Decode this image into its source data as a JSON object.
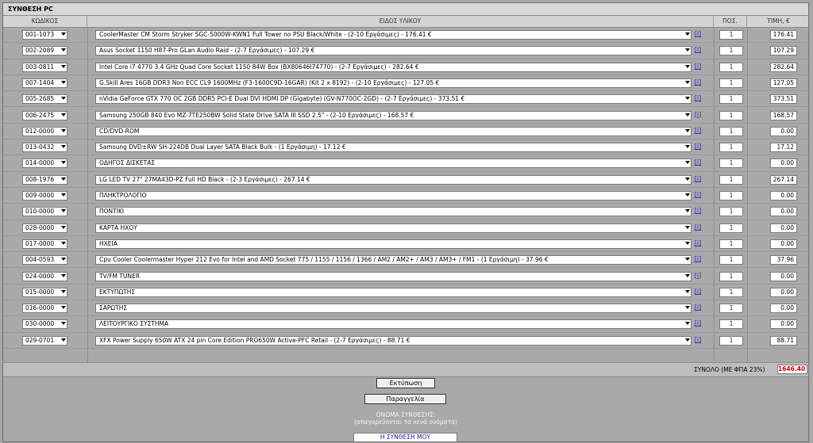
{
  "title": "ΣΥΝΘΕΣΗ PC",
  "headers": {
    "code": "ΚΩΔΙΚΟΣ",
    "description": "ΕΙΔΟΣ ΥΛΙΚΟΥ",
    "quantity": "ΠΟΣ.",
    "price": "ΤΙΜΗ, €"
  },
  "info_icon": "[i]",
  "rows": [
    {
      "code": "001-1073",
      "description": "CoolerMaster CM Storm Stryker SGC-5000W-KWN1 Full Tower no PSU Black/White - (2-10 Εργάσιμες) - 176.41 €",
      "qty": "1",
      "price": "176.41"
    },
    {
      "code": "002-2089",
      "description": "Asus Socket 1150 H87-Pro GLan Audio Raid - (2-7 Εργάσιμες) - 107.29 €",
      "qty": "1",
      "price": "107.29"
    },
    {
      "code": "003-0811",
      "description": "Intel Core i7 4770 3.4 GHz Quad Core Socket 1150 84W Box (BX80646I74770) - (2-7 Εργάσιμες) - 282.64 €",
      "qty": "1",
      "price": "282.64"
    },
    {
      "code": "007-1404",
      "description": "G.Skill Ares 16GB DDR3 Non ECC CL9 1600MHz (F3-1600C9D-16GAR) (Kit 2 x 8192) - (2-10 Εργάσιμες) - 127.05 €",
      "qty": "1",
      "price": "127.05"
    },
    {
      "code": "005-2685",
      "description": "nVidia GeForce GTX 770 OC 2GB DDR5 PCI-E Dual DVI HDMI DP (Gigabyte) (GV-N770OC-2GD) - (2-7 Εργάσιμες) - 373.51 €",
      "qty": "1",
      "price": "373.51"
    },
    {
      "code": "006-2475",
      "description": "Samsung 250GB 840 Evo MZ-7TE250BW Solid State Drive SATA III SSD 2.5\" - (2-10 Εργάσιμες) - 168.57 €",
      "qty": "1",
      "price": "168.57"
    },
    {
      "code": "012-0000",
      "description": "CD/DVD-ROM",
      "qty": "1",
      "price": "0.00"
    },
    {
      "code": "013-0432",
      "description": "Samsung DVD±RW SH-224DB Dual Layer SATA Black Bulk - (1 Εργάσιμη) - 17.12 €",
      "qty": "1",
      "price": "17.12"
    },
    {
      "code": "014-0000",
      "description": "ΟΔΗΓΟΣ ΔΙΣΚΕΤΑΣ",
      "qty": "1",
      "price": "0.00"
    },
    {
      "code": "008-1976",
      "description": "LG LED TV 27\" 27MA43D-PZ Full HD Black - (2-3 Εργάσιμες) - 267.14 €",
      "qty": "1",
      "price": "267.14"
    },
    {
      "code": "009-0000",
      "description": "ΠΛΗΚΤΡΟΛΟΓΙΟ",
      "qty": "1",
      "price": "0.00"
    },
    {
      "code": "010-0000",
      "description": "ΠΟΝΤΙΚΙ",
      "qty": "1",
      "price": "0.00"
    },
    {
      "code": "028-0000",
      "description": "ΚΑΡΤΑ ΗΧΟΥ",
      "qty": "1",
      "price": "0.00"
    },
    {
      "code": "017-0000",
      "description": "ΗΧΕΙΑ",
      "qty": "1",
      "price": "0.00"
    },
    {
      "code": "004-0593",
      "description": "Cpu Cooler Coolermaster Hyper 212 Evo for Intel and AMD Socket 775 / 1155 / 1156 / 1366 / AM2 / AM2+ / AM3 / AM3+ / FM1 - (1 Εργάσιμη) - 37.96 €",
      "qty": "1",
      "price": "37.96"
    },
    {
      "code": "024-0000",
      "description": "TV/FM TUNER",
      "qty": "1",
      "price": "0.00"
    },
    {
      "code": "015-0000",
      "description": "ΕΚΤΥΠΩΤΗΣ",
      "qty": "1",
      "price": "0.00"
    },
    {
      "code": "016-0000",
      "description": "ΣΑΡΩΤΗΣ",
      "qty": "1",
      "price": "0.00"
    },
    {
      "code": "030-0000",
      "description": "ΛΕΙΤΟΥΡΓΙΚΟ ΣΥΣΤΗΜΑ",
      "qty": "1",
      "price": "0.00"
    },
    {
      "code": "029-0701",
      "description": "XFX Power Supply 650W ATX 24 pin Core Edition PRO650W Active-PFC Retail - (2-7 Εργάσιμες) - 88.71 €",
      "qty": "1",
      "price": "88.71"
    }
  ],
  "total": {
    "label": "ΣΥΝΟΛΟ (ΜΕ ΦΠΑ 23%)",
    "value": "1646.40"
  },
  "buttons": {
    "print": "Εκτύπωση",
    "order": "Παραγγελία"
  },
  "composition_name": {
    "label": "ΟΝΟΜΑ ΣΥΝΘΕΣΗΣ:",
    "hint": "(απαγορεύονται τα κενά ονόματα)",
    "value": "Η ΣΥΝΘΕΣΗ ΜΟΥ"
  },
  "colors": {
    "total_value": "#cc0000",
    "info_icon": "#3434c8",
    "background": "#a8a8a8"
  }
}
